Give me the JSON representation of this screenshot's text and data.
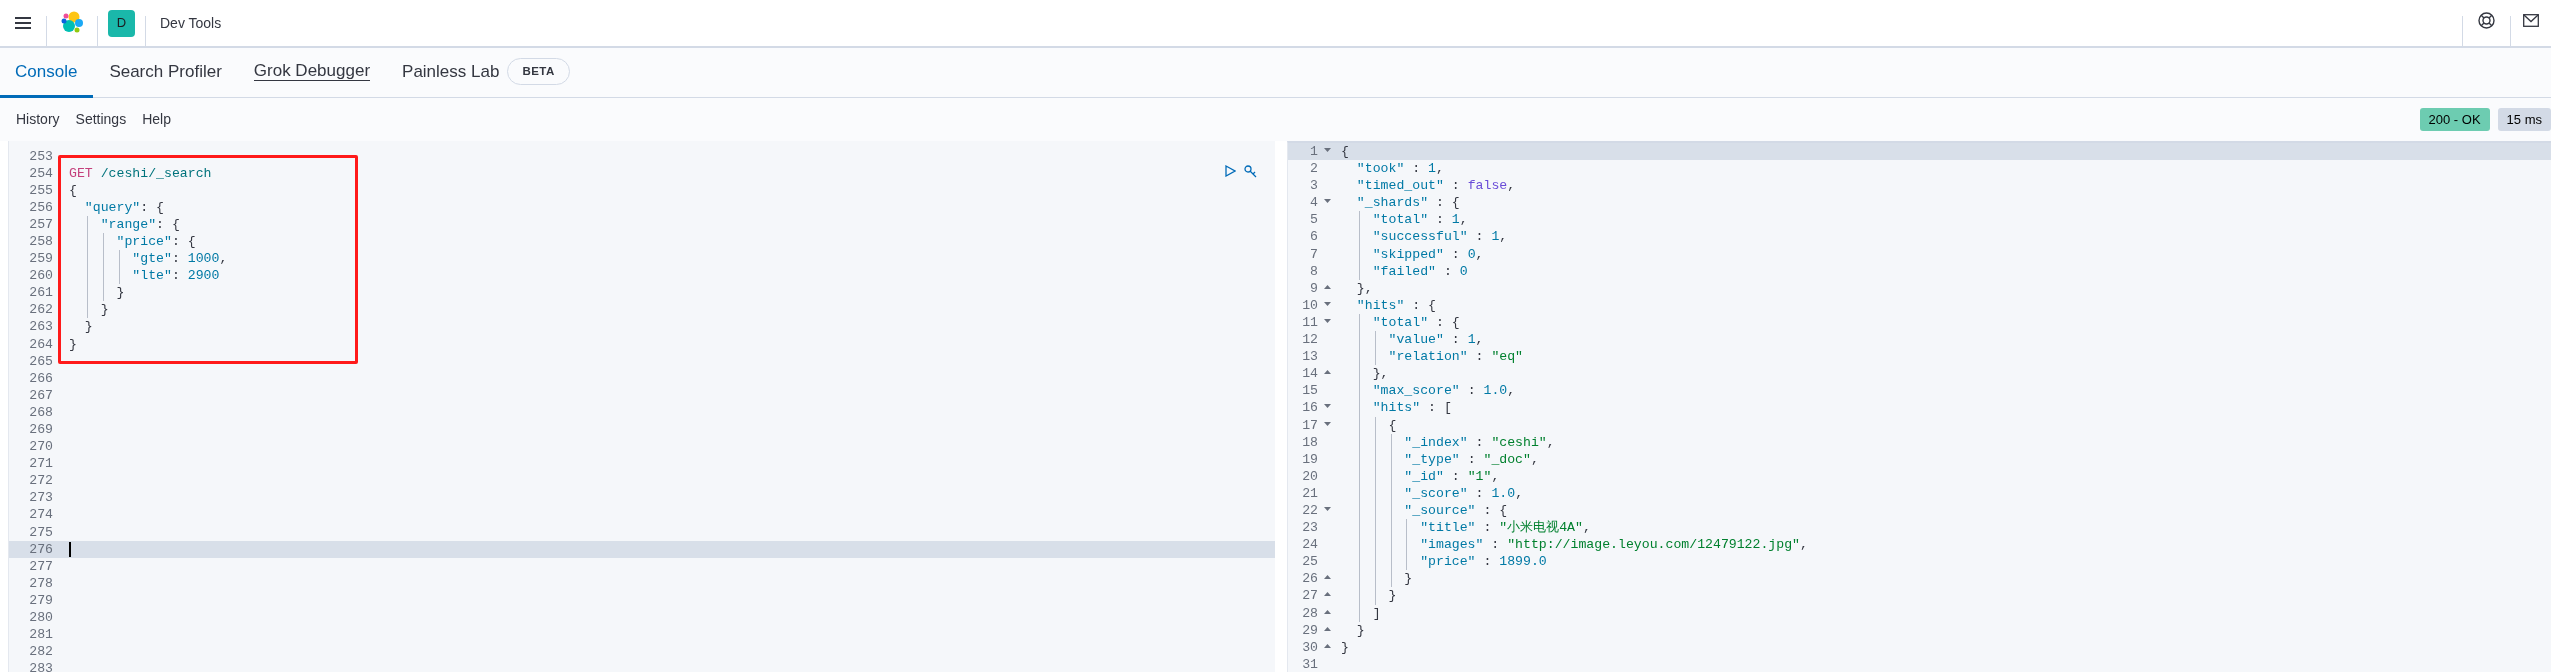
{
  "header": {
    "space_avatar": "D",
    "title": "Dev Tools"
  },
  "tabs": [
    {
      "label": "Console",
      "selected": true,
      "hovered": false
    },
    {
      "label": "Search Profiler",
      "selected": false,
      "hovered": false
    },
    {
      "label": "Grok Debugger",
      "selected": false,
      "hovered": true
    },
    {
      "label": "Painless Lab",
      "selected": false,
      "hovered": false,
      "badge": "BETA"
    }
  ],
  "menu": [
    "History",
    "Settings",
    "Help"
  ],
  "response_badges": [
    {
      "kind": "status",
      "text": "200 - OK"
    },
    {
      "kind": "time",
      "text": "15 ms"
    }
  ],
  "request_editor": {
    "annotation": {
      "kind": "box"
    },
    "lines": [
      {
        "number": "253",
        "active": false
      },
      {
        "number": "254",
        "active": false,
        "code": "GET /ceshi/_search"
      },
      {
        "number": "255",
        "active": false,
        "code": "{"
      },
      {
        "number": "256",
        "active": false,
        "code": "  \"query\": {"
      },
      {
        "number": "257",
        "active": false,
        "code": "    \"range\": {"
      },
      {
        "number": "258",
        "active": false,
        "code": "      \"price\": {"
      },
      {
        "number": "259",
        "active": false,
        "code": "        \"gte\": 1000,"
      },
      {
        "number": "260",
        "active": false,
        "code": "        \"lte\": 2900"
      },
      {
        "number": "261",
        "active": false,
        "code": "      }"
      },
      {
        "number": "262",
        "active": false,
        "code": "    }"
      },
      {
        "number": "263",
        "active": false,
        "code": "  }"
      },
      {
        "number": "264",
        "active": false,
        "code": "}"
      },
      {
        "number": "265",
        "active": false
      },
      {
        "number": "266",
        "active": false
      },
      {
        "number": "267",
        "active": false
      },
      {
        "number": "268",
        "active": false
      },
      {
        "number": "269",
        "active": false
      },
      {
        "number": "270",
        "active": false
      },
      {
        "number": "271",
        "active": false
      },
      {
        "number": "272",
        "active": false
      },
      {
        "number": "273",
        "active": false
      },
      {
        "number": "274",
        "active": false
      },
      {
        "number": "275",
        "active": false
      },
      {
        "number": "276",
        "active": true,
        "cursor": true
      },
      {
        "number": "277",
        "active": false
      },
      {
        "number": "278",
        "active": false
      },
      {
        "number": "279",
        "active": false
      },
      {
        "number": "280",
        "active": false
      },
      {
        "number": "281",
        "active": false
      },
      {
        "number": "282",
        "active": false
      },
      {
        "number": "283",
        "active": false
      }
    ]
  },
  "response_editor": {
    "lines": [
      {
        "number": "1",
        "active": true,
        "fold_start": true,
        "fold_end": false,
        "code": "{"
      },
      {
        "number": "2",
        "active": false,
        "fold_start": false,
        "fold_end": false,
        "code": "  \"took\" : 1,"
      },
      {
        "number": "3",
        "active": false,
        "fold_start": false,
        "fold_end": false,
        "code": "  \"timed_out\" : false,"
      },
      {
        "number": "4",
        "active": false,
        "fold_start": true,
        "fold_end": false,
        "code": "  \"_shards\" : {"
      },
      {
        "number": "5",
        "active": false,
        "fold_start": false,
        "fold_end": false,
        "code": "    \"total\" : 1,"
      },
      {
        "number": "6",
        "active": false,
        "fold_start": false,
        "fold_end": false,
        "code": "    \"successful\" : 1,"
      },
      {
        "number": "7",
        "active": false,
        "fold_start": false,
        "fold_end": false,
        "code": "    \"skipped\" : 0,"
      },
      {
        "number": "8",
        "active": false,
        "fold_start": false,
        "fold_end": false,
        "code": "    \"failed\" : 0"
      },
      {
        "number": "9",
        "active": false,
        "fold_start": false,
        "fold_end": true,
        "code": "  },"
      },
      {
        "number": "10",
        "active": false,
        "fold_start": true,
        "fold_end": false,
        "code": "  \"hits\" : {"
      },
      {
        "number": "11",
        "active": false,
        "fold_start": true,
        "fold_end": false,
        "code": "    \"total\" : {"
      },
      {
        "number": "12",
        "active": false,
        "fold_start": false,
        "fold_end": false,
        "code": "      \"value\" : 1,"
      },
      {
        "number": "13",
        "active": false,
        "fold_start": false,
        "fold_end": false,
        "code": "      \"relation\" : \"eq\""
      },
      {
        "number": "14",
        "active": false,
        "fold_start": false,
        "fold_end": true,
        "code": "    },"
      },
      {
        "number": "15",
        "active": false,
        "fold_start": false,
        "fold_end": false,
        "code": "    \"max_score\" : 1.0,"
      },
      {
        "number": "16",
        "active": false,
        "fold_start": true,
        "fold_end": false,
        "code": "    \"hits\" : ["
      },
      {
        "number": "17",
        "active": false,
        "fold_start": true,
        "fold_end": false,
        "code": "      {"
      },
      {
        "number": "18",
        "active": false,
        "fold_start": false,
        "fold_end": false,
        "code": "        \"_index\" : \"ceshi\","
      },
      {
        "number": "19",
        "active": false,
        "fold_start": false,
        "fold_end": false,
        "code": "        \"_type\" : \"_doc\","
      },
      {
        "number": "20",
        "active": false,
        "fold_start": false,
        "fold_end": false,
        "code": "        \"_id\" : \"1\","
      },
      {
        "number": "21",
        "active": false,
        "fold_start": false,
        "fold_end": false,
        "code": "        \"_score\" : 1.0,"
      },
      {
        "number": "22",
        "active": false,
        "fold_start": true,
        "fold_end": false,
        "code": "        \"_source\" : {"
      },
      {
        "number": "23",
        "active": false,
        "fold_start": false,
        "fold_end": false,
        "code": "          \"title\" : \"小米电视4A\","
      },
      {
        "number": "24",
        "active": false,
        "fold_start": false,
        "fold_end": false,
        "code": "          \"images\" : \"http://image.leyou.com/12479122.jpg\","
      },
      {
        "number": "25",
        "active": false,
        "fold_start": false,
        "fold_end": false,
        "code": "          \"price\" : 1899.0"
      },
      {
        "number": "26",
        "active": false,
        "fold_start": false,
        "fold_end": true,
        "code": "        }"
      },
      {
        "number": "27",
        "active": false,
        "fold_start": false,
        "fold_end": true,
        "code": "      }"
      },
      {
        "number": "28",
        "active": false,
        "fold_start": false,
        "fold_end": true,
        "code": "    ]"
      },
      {
        "number": "29",
        "active": false,
        "fold_start": false,
        "fold_end": true,
        "code": "  }"
      },
      {
        "number": "30",
        "active": false,
        "fold_start": false,
        "fold_end": true,
        "code": "}"
      },
      {
        "number": "31",
        "active": false,
        "fold_start": false,
        "fold_end": false
      }
    ]
  }
}
